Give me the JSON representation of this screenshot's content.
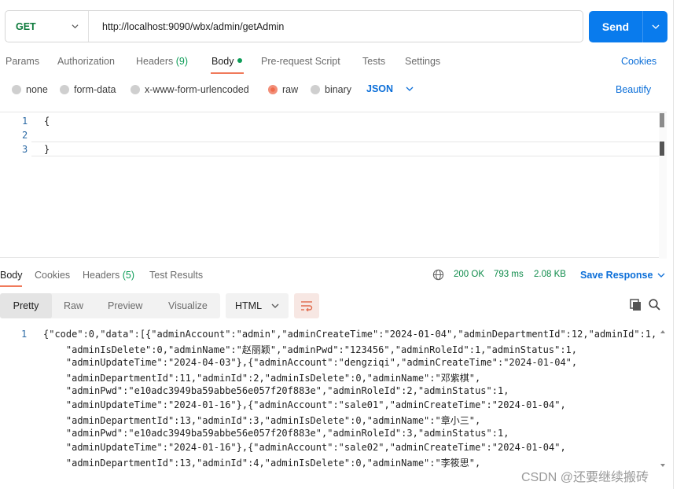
{
  "request": {
    "method": "GET",
    "url": "http://localhost:9090/wbx/admin/getAdmin",
    "send_label": "Send"
  },
  "tabs": {
    "params": "Params",
    "authorization": "Authorization",
    "headers": "Headers",
    "headers_count": "(9)",
    "body": "Body",
    "prerequest": "Pre-request Script",
    "tests": "Tests",
    "settings": "Settings",
    "cookies": "Cookies"
  },
  "body_types": {
    "none": "none",
    "form_data": "form-data",
    "urlencoded": "x-www-form-urlencoded",
    "raw": "raw",
    "binary": "binary",
    "selected": "raw",
    "language": "JSON",
    "beautify": "Beautify"
  },
  "request_editor": {
    "lines": [
      {
        "n": "1",
        "text": "{"
      },
      {
        "n": "2",
        "text": ""
      },
      {
        "n": "3",
        "text": "}"
      }
    ]
  },
  "response": {
    "tabs": {
      "body": "Body",
      "cookies": "Cookies",
      "headers": "Headers",
      "headers_count": "(5)",
      "test_results": "Test Results"
    },
    "status": "200 OK",
    "time": "793 ms",
    "size": "2.08 KB",
    "save_label": "Save Response",
    "formats": {
      "pretty": "Pretty",
      "raw": "Raw",
      "preview": "Preview",
      "visualize": "Visualize"
    },
    "format_type": "HTML",
    "line_number": "1",
    "lines": [
      "{\"code\":0,\"data\":[{\"adminAccount\":\"admin\",\"adminCreateTime\":\"2024-01-04\",\"adminDepartmentId\":12,\"adminId\":1,",
      "    \"adminIsDelete\":0,\"adminName\":\"赵丽颖\",\"adminPwd\":\"123456\",\"adminRoleId\":1,\"adminStatus\":1,",
      "    \"adminUpdateTime\":\"2024-04-03\"},{\"adminAccount\":\"dengziqi\",\"adminCreateTime\":\"2024-01-04\",",
      "    \"adminDepartmentId\":11,\"adminId\":2,\"adminIsDelete\":0,\"adminName\":\"邓紫棋\",",
      "    \"adminPwd\":\"e10adc3949ba59abbe56e057f20f883e\",\"adminRoleId\":2,\"adminStatus\":1,",
      "    \"adminUpdateTime\":\"2024-01-16\"},{\"adminAccount\":\"sale01\",\"adminCreateTime\":\"2024-01-04\",",
      "    \"adminDepartmentId\":13,\"adminId\":3,\"adminIsDelete\":0,\"adminName\":\"章小三\",",
      "    \"adminPwd\":\"e10adc3949ba59abbe56e057f20f883e\",\"adminRoleId\":3,\"adminStatus\":1,",
      "    \"adminUpdateTime\":\"2024-01-16\"},{\"adminAccount\":\"sale02\",\"adminCreateTime\":\"2024-01-04\",",
      "    \"adminDepartmentId\":13,\"adminId\":4,\"adminIsDelete\":0,\"adminName\":\"李筱思\","
    ]
  },
  "watermark": "CSDN @还要继续搬砖",
  "icons": {
    "globe": "globe-icon",
    "copy": "copy-icon",
    "search": "search-icon",
    "wrap": "wrap-lines-icon"
  },
  "colors": {
    "accent": "#097bed",
    "method_get": "#0d7a3b",
    "status_ok": "#0d8a49",
    "link": "#0b6ed8",
    "raw_selected": "#ef6b4c"
  }
}
